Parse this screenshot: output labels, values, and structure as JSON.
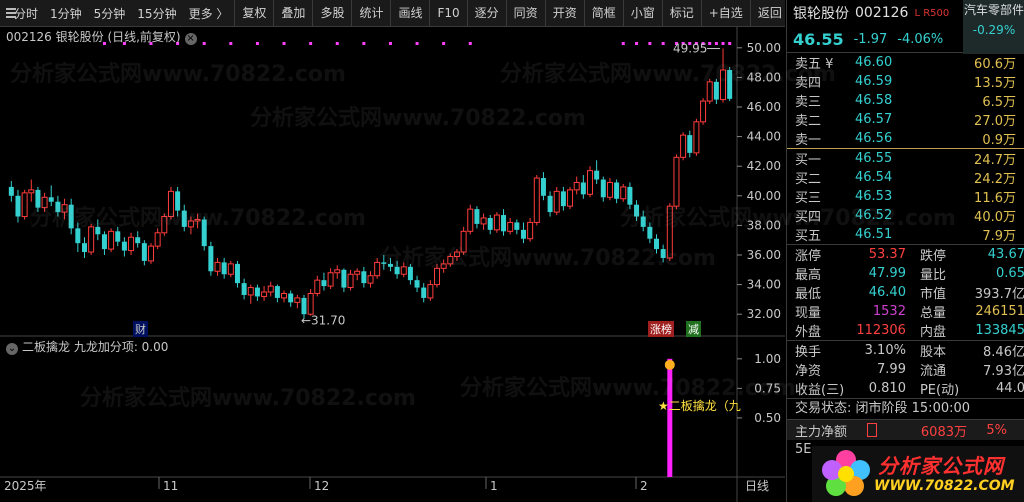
{
  "toolbar": {
    "left": [
      "分时",
      "1分钟",
      "5分钟",
      "15分钟",
      "更多 〉"
    ],
    "right": [
      "复权",
      "叠加",
      "多股",
      "统计",
      "画线",
      "F10",
      "逐分",
      "同资",
      "开资",
      "简框",
      "小窗",
      "标记",
      "+自选",
      "返回"
    ]
  },
  "chart": {
    "header": "002126 银轮股份 (日线,前复权)",
    "close_glyph": "×",
    "indicator_header": "二板擒龙  九龙加分项: 0.00",
    "price_axis": [
      "50.00",
      "48.00",
      "46.00",
      "44.00",
      "42.00",
      "40.00",
      "38.00",
      "36.00",
      "34.00",
      "32.00"
    ],
    "indicator_axis": [
      "1.00",
      "0.75",
      "0.50"
    ],
    "date_axis": [
      "2025年",
      "11",
      "12",
      "1",
      "2",
      "日线"
    ],
    "max_label": "49.95",
    "min_label": "←31.70",
    "badges": [
      "财",
      "涨榜",
      "减"
    ],
    "signal_label": "★二板擒龙（九"
  },
  "chart_data": {
    "type": "candlestick",
    "ylim": [
      31,
      51
    ],
    "candles": [
      [
        40.6,
        41.0,
        39.6,
        40.0
      ],
      [
        40.0,
        40.4,
        38.2,
        38.6
      ],
      [
        38.6,
        40.4,
        38.4,
        40.2
      ],
      [
        40.2,
        41.1,
        39.6,
        40.4
      ],
      [
        40.4,
        40.6,
        38.9,
        39.2
      ],
      [
        39.2,
        40.2,
        38.9,
        39.9
      ],
      [
        39.9,
        40.7,
        39.3,
        39.6
      ],
      [
        39.6,
        40.0,
        38.6,
        38.9
      ],
      [
        38.9,
        39.8,
        38.4,
        39.4
      ],
      [
        39.4,
        39.8,
        37.4,
        37.8
      ],
      [
        37.8,
        38.2,
        36.2,
        36.8
      ],
      [
        36.8,
        37.2,
        35.8,
        36.2
      ],
      [
        36.2,
        38.1,
        36.0,
        37.9
      ],
      [
        37.9,
        38.4,
        37.0,
        37.4
      ],
      [
        37.4,
        37.6,
        36.0,
        36.4
      ],
      [
        36.4,
        37.8,
        36.2,
        37.6
      ],
      [
        37.6,
        37.9,
        36.6,
        36.9
      ],
      [
        36.9,
        37.2,
        35.9,
        36.3
      ],
      [
        36.3,
        37.5,
        36.0,
        37.2
      ],
      [
        37.2,
        37.6,
        36.5,
        36.8
      ],
      [
        36.8,
        37.0,
        35.3,
        35.6
      ],
      [
        35.6,
        36.8,
        35.4,
        36.6
      ],
      [
        36.6,
        37.8,
        36.4,
        37.5
      ],
      [
        37.5,
        38.8,
        37.3,
        38.6
      ],
      [
        38.6,
        40.6,
        38.4,
        40.3
      ],
      [
        40.3,
        40.6,
        38.6,
        39.0
      ],
      [
        39.0,
        39.4,
        37.6,
        37.9
      ],
      [
        37.9,
        38.6,
        37.4,
        38.3
      ],
      [
        38.3,
        38.8,
        37.8,
        38.4
      ],
      [
        38.4,
        38.6,
        36.3,
        36.6
      ],
      [
        36.6,
        36.9,
        34.6,
        34.9
      ],
      [
        34.9,
        35.8,
        34.6,
        35.5
      ],
      [
        35.5,
        35.8,
        34.4,
        34.7
      ],
      [
        34.7,
        35.6,
        34.5,
        35.4
      ],
      [
        35.4,
        35.6,
        33.8,
        34.1
      ],
      [
        34.1,
        34.4,
        33.0,
        33.3
      ],
      [
        33.3,
        34.0,
        32.7,
        33.8
      ],
      [
        33.8,
        34.0,
        32.9,
        33.2
      ],
      [
        33.2,
        33.9,
        32.9,
        33.5
      ],
      [
        33.5,
        34.2,
        33.2,
        33.9
      ],
      [
        33.9,
        34.0,
        32.8,
        33.1
      ],
      [
        33.1,
        33.6,
        32.8,
        33.4
      ],
      [
        33.4,
        33.6,
        32.5,
        32.8
      ],
      [
        32.8,
        33.3,
        32.4,
        33.1
      ],
      [
        33.1,
        33.3,
        31.7,
        32.0
      ],
      [
        32.0,
        33.7,
        31.9,
        33.4
      ],
      [
        33.4,
        34.6,
        33.2,
        34.3
      ],
      [
        34.3,
        34.8,
        33.6,
        33.9
      ],
      [
        33.9,
        35.1,
        33.7,
        34.8
      ],
      [
        34.8,
        35.3,
        34.4,
        35.0
      ],
      [
        35.0,
        35.1,
        33.5,
        33.8
      ],
      [
        33.8,
        35.0,
        33.6,
        34.7
      ],
      [
        34.7,
        35.1,
        34.3,
        34.9
      ],
      [
        34.9,
        35.2,
        33.8,
        34.1
      ],
      [
        34.1,
        34.9,
        33.8,
        34.6
      ],
      [
        34.6,
        35.8,
        34.4,
        35.5
      ],
      [
        35.5,
        36.0,
        35.0,
        35.4
      ],
      [
        35.4,
        35.8,
        34.9,
        35.2
      ],
      [
        35.2,
        35.6,
        34.4,
        34.7
      ],
      [
        34.7,
        35.5,
        34.5,
        35.2
      ],
      [
        35.2,
        35.4,
        34.0,
        34.3
      ],
      [
        34.3,
        34.6,
        33.5,
        33.8
      ],
      [
        33.8,
        34.1,
        32.8,
        33.1
      ],
      [
        33.1,
        34.3,
        32.9,
        34.0
      ],
      [
        34.0,
        35.4,
        33.8,
        35.1
      ],
      [
        35.1,
        35.7,
        34.8,
        35.4
      ],
      [
        35.4,
        36.1,
        35.2,
        35.9
      ],
      [
        35.9,
        36.4,
        35.6,
        36.2
      ],
      [
        36.2,
        37.9,
        36.0,
        37.6
      ],
      [
        37.6,
        39.4,
        37.4,
        39.1
      ],
      [
        39.1,
        39.3,
        37.8,
        38.1
      ],
      [
        38.1,
        38.8,
        37.7,
        38.5
      ],
      [
        38.5,
        38.7,
        37.4,
        37.7
      ],
      [
        37.7,
        38.9,
        37.5,
        38.7
      ],
      [
        38.7,
        39.1,
        37.3,
        37.6
      ],
      [
        37.6,
        38.5,
        37.4,
        38.2
      ],
      [
        38.2,
        38.4,
        37.4,
        37.7
      ],
      [
        37.7,
        38.2,
        36.8,
        37.1
      ],
      [
        37.1,
        38.5,
        36.9,
        38.2
      ],
      [
        38.2,
        41.4,
        38.0,
        41.2
      ],
      [
        41.2,
        41.6,
        39.7,
        40.0
      ],
      [
        40.0,
        40.3,
        38.6,
        38.9
      ],
      [
        38.9,
        40.6,
        38.7,
        40.3
      ],
      [
        40.3,
        40.6,
        39.0,
        39.3
      ],
      [
        39.3,
        40.6,
        39.1,
        40.4
      ],
      [
        40.4,
        41.3,
        40.1,
        40.9
      ],
      [
        40.9,
        41.4,
        39.8,
        40.1
      ],
      [
        40.1,
        42.0,
        39.9,
        41.7
      ],
      [
        41.7,
        42.4,
        40.8,
        41.1
      ],
      [
        41.1,
        41.3,
        39.6,
        39.9
      ],
      [
        39.9,
        41.2,
        39.7,
        40.9
      ],
      [
        40.9,
        41.1,
        39.5,
        39.8
      ],
      [
        39.8,
        40.8,
        39.6,
        40.6
      ],
      [
        40.6,
        40.9,
        39.1,
        39.4
      ],
      [
        39.4,
        39.7,
        38.3,
        38.6
      ],
      [
        38.6,
        39.0,
        37.6,
        37.9
      ],
      [
        37.9,
        38.2,
        36.8,
        37.1
      ],
      [
        37.1,
        37.4,
        36.1,
        36.4
      ],
      [
        36.4,
        36.7,
        35.5,
        35.8
      ],
      [
        35.8,
        39.5,
        35.6,
        39.3
      ],
      [
        39.3,
        42.8,
        39.1,
        42.6
      ],
      [
        42.6,
        44.3,
        42.4,
        44.1
      ],
      [
        44.1,
        44.4,
        42.6,
        42.9
      ],
      [
        42.9,
        45.2,
        42.7,
        45.0
      ],
      [
        45.0,
        46.6,
        44.8,
        46.4
      ],
      [
        46.4,
        47.9,
        46.2,
        47.7
      ],
      [
        47.7,
        47.9,
        46.2,
        46.5
      ],
      [
        46.5,
        49.95,
        46.3,
        48.5
      ],
      [
        48.5,
        48.7,
        46.4,
        46.55
      ]
    ],
    "signal_value": 1.0,
    "signal_ylim": [
      0,
      1.1
    ]
  },
  "quote": {
    "name": "银轮股份",
    "code": "002126",
    "lr": "L R500",
    "sector": "汽车零部件",
    "sector_pct": "-0.29%",
    "price": "46.55",
    "change": "-1.97",
    "change_pct": "-4.06%",
    "asks": [
      {
        "label": "卖五 ¥",
        "price": "46.60",
        "vol": "60.6万"
      },
      {
        "label": "卖四",
        "price": "46.59",
        "vol": "13.5万"
      },
      {
        "label": "卖三",
        "price": "46.58",
        "vol": "6.5万"
      },
      {
        "label": "卖二",
        "price": "46.57",
        "vol": "27.0万"
      },
      {
        "label": "卖一",
        "price": "46.56",
        "vol": "0.9万"
      }
    ],
    "bids": [
      {
        "label": "买一",
        "price": "46.55",
        "vol": "24.7万"
      },
      {
        "label": "买二",
        "price": "46.54",
        "vol": "24.2万"
      },
      {
        "label": "买三",
        "price": "46.53",
        "vol": "11.6万"
      },
      {
        "label": "买四",
        "price": "46.52",
        "vol": "40.0万"
      },
      {
        "label": "买五",
        "price": "46.51",
        "vol": "7.9万"
      }
    ],
    "stats1": [
      {
        "l1": "涨停",
        "v1": "53.37",
        "c1": "#ff4040",
        "l2": "跌停",
        "v2": "43.67",
        "c2": "#35d0d0"
      },
      {
        "l1": "最高",
        "v1": "47.99",
        "c1": "#35d0d0",
        "l2": "量比",
        "v2": "0.65",
        "c2": "#35d0d0"
      },
      {
        "l1": "最低",
        "v1": "46.40",
        "c1": "#35d0d0",
        "l2": "市值",
        "v2": "393.7亿",
        "c2": "#c8c8c8"
      },
      {
        "l1": "现量",
        "v1": "1532",
        "c1": "#d040d0",
        "l2": "总量",
        "v2": "246151",
        "c2": "#e0c050"
      },
      {
        "l1": "外盘",
        "v1": "112306",
        "c1": "#ff4040",
        "l2": "内盘",
        "v2": "133845",
        "c2": "#35d0d0"
      }
    ],
    "stats2": [
      {
        "l1": "换手",
        "v1": "3.10%",
        "c1": "#c8c8c8",
        "l2": "股本",
        "v2": "8.46亿",
        "c2": "#c8c8c8"
      },
      {
        "l1": "净资",
        "v1": "7.99",
        "c1": "#c8c8c8",
        "l2": "流通",
        "v2": "7.93亿",
        "c2": "#c8c8c8"
      },
      {
        "l1": "收益(三)",
        "v1": "0.810",
        "c1": "#c8c8c8",
        "l2": "PE(动)",
        "v2": "44.0",
        "c2": "#c8c8c8"
      }
    ],
    "trade_status": "交易状态: 闭市阶段 15:00:00",
    "main_flow_label": "主力净额",
    "main_flow_value": "6083万",
    "main_flow_pct": "5%",
    "row_5e": "5E"
  },
  "logo": {
    "text": "分析家公式网",
    "url": "WWW.70822.COM"
  },
  "watermark": "分析家公式网www.70822.com",
  "colors": {
    "up": "#ff3c3c",
    "down": "#35d0d0",
    "signal": "#ff20ff"
  }
}
